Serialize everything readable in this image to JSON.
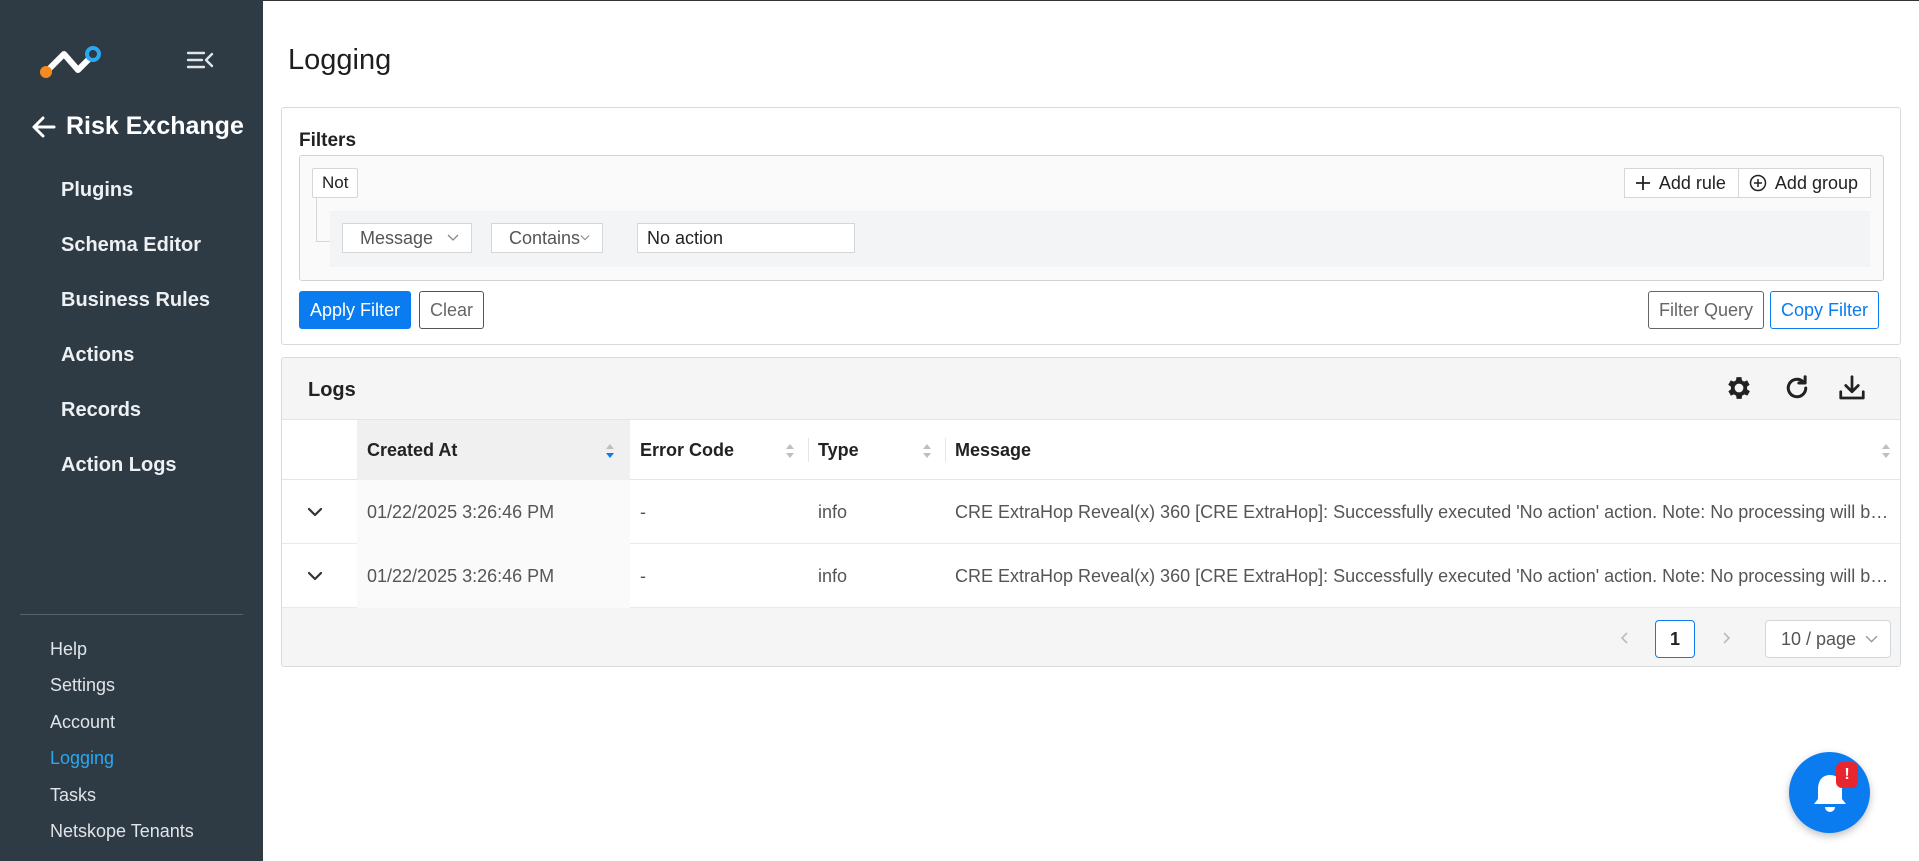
{
  "sidebar": {
    "back_title": "Risk Exchange",
    "nav": [
      {
        "label": "Plugins"
      },
      {
        "label": "Schema Editor"
      },
      {
        "label": "Business Rules"
      },
      {
        "label": "Actions"
      },
      {
        "label": "Records"
      },
      {
        "label": "Action Logs"
      }
    ],
    "bottom_nav": [
      {
        "label": "Help"
      },
      {
        "label": "Settings"
      },
      {
        "label": "Account"
      },
      {
        "label": "Logging",
        "active": true
      },
      {
        "label": "Tasks"
      },
      {
        "label": "Netskope Tenants"
      }
    ]
  },
  "page": {
    "title": "Logging"
  },
  "filters": {
    "label": "Filters",
    "not_label": "Not",
    "add_rule_label": "Add rule",
    "add_group_label": "Add group",
    "rule": {
      "field": "Message",
      "operator": "Contains",
      "value": "No action"
    },
    "apply_label": "Apply Filter",
    "clear_label": "Clear",
    "filter_query_label": "Filter Query",
    "copy_filter_label": "Copy Filter"
  },
  "logs": {
    "title": "Logs",
    "columns": [
      "Created At",
      "Error Code",
      "Type",
      "Message"
    ],
    "rows": [
      {
        "created_at": "01/22/2025 3:26:46 PM",
        "error_code": "-",
        "type": "info",
        "message": "CRE ExtraHop Reveal(x) 360 [CRE ExtraHop]: Successfully executed 'No action' action. Note: No processing will be done from Cloud Exchange for 'No action' action."
      },
      {
        "created_at": "01/22/2025 3:26:46 PM",
        "error_code": "-",
        "type": "info",
        "message": "CRE ExtraHop Reveal(x) 360 [CRE ExtraHop]: Successfully executed 'No action' action. Note: No processing will be done from Cloud Exchange for 'No action' action."
      }
    ],
    "pagination": {
      "current_page": "1",
      "page_size": "10 / page"
    }
  },
  "notifications": {
    "badge": "!"
  },
  "colors": {
    "sidebar_bg": "#2e3a44",
    "accent": "#0a7cf0",
    "active_nav": "#2aa8f0",
    "badge": "#e8262d"
  },
  "icons": [
    "logo-icon",
    "menu-collapse-icon",
    "arrow-left-icon",
    "plus-icon",
    "plus-circle-icon",
    "chevron-down-icon",
    "gear-icon",
    "refresh-icon",
    "download-icon",
    "sort-icon",
    "chevron-left-icon",
    "chevron-right-icon",
    "bell-icon"
  ]
}
